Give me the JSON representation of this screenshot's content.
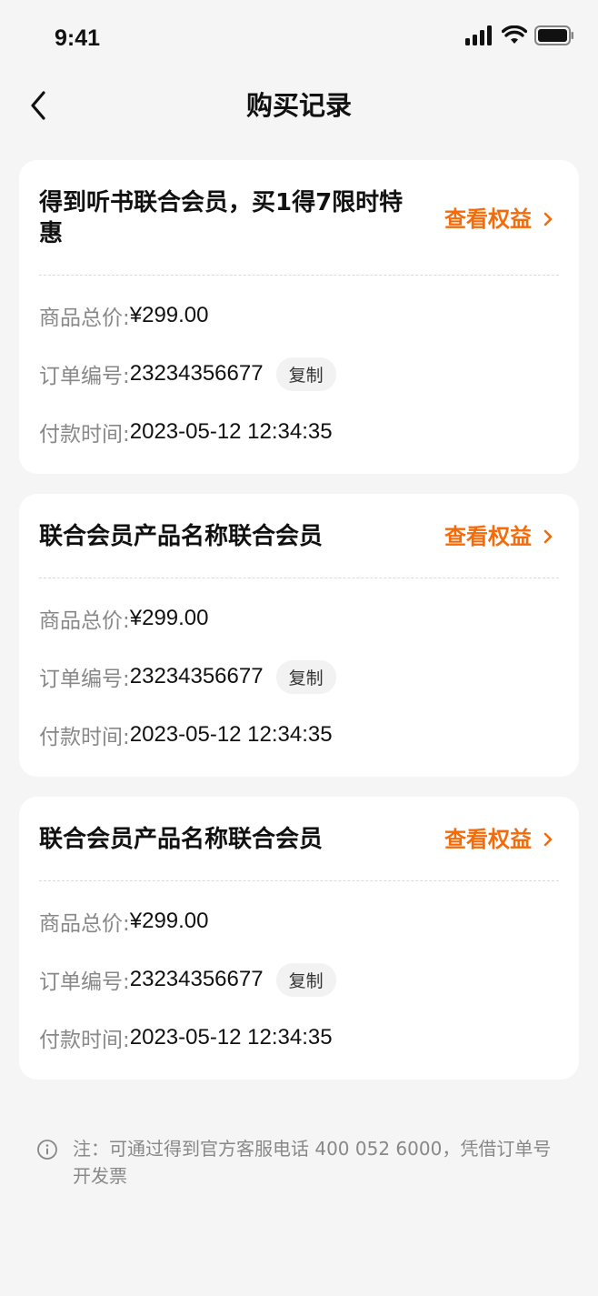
{
  "status_bar": {
    "time": "9:41"
  },
  "nav": {
    "title": "购买记录"
  },
  "labels": {
    "total": "商品总价:",
    "order_no": "订单编号:",
    "pay_time": "付款时间:",
    "copy": "复制",
    "view_benefits": "查看权益"
  },
  "orders": [
    {
      "title": "得到听书联合会员，买1得7限时特惠",
      "total": "¥299.00",
      "order_no": "23234356677",
      "pay_time": "2023-05-12 12:34:35"
    },
    {
      "title": "联合会员产品名称联合会员",
      "total": "¥299.00",
      "order_no": "23234356677",
      "pay_time": "2023-05-12 12:34:35"
    },
    {
      "title": "联合会员产品名称联合会员",
      "total": "¥299.00",
      "order_no": "23234356677",
      "pay_time": "2023-05-12 12:34:35"
    }
  ],
  "note": {
    "text": "注：可通过得到官方客服电话 400 052 6000，凭借订单号开发票"
  },
  "colors": {
    "accent": "#f46b0a",
    "background": "#f5f5f5"
  },
  "icons": {
    "back": "chevron-left-icon",
    "link": "chevron-right-icon",
    "info": "info-icon"
  }
}
